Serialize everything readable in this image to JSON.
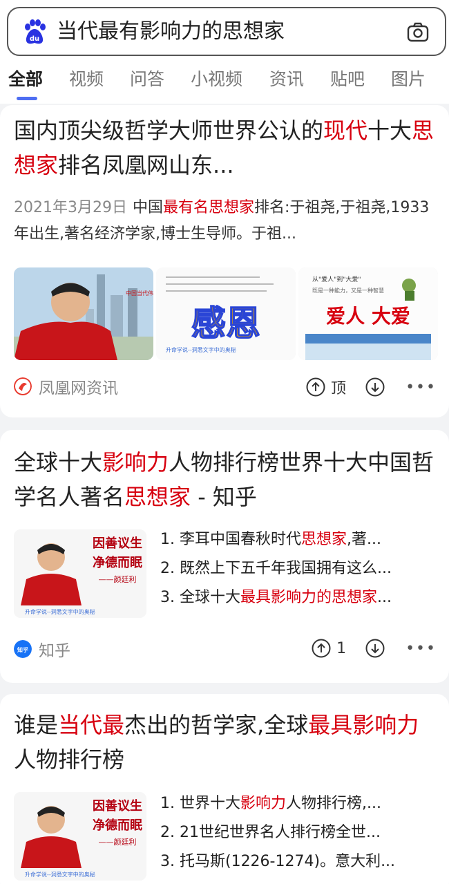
{
  "search": {
    "query": "当代最有影响力的思想家"
  },
  "tabs": [
    "全部",
    "视频",
    "问答",
    "小视频",
    "资讯",
    "贴吧",
    "图片"
  ],
  "cards": [
    {
      "title": {
        "p1": "国内顶尖级哲学大师世界公认的",
        "h1": "现代",
        "p2": "十大",
        "h2": "思想家",
        "p3": "排名凤凰网山东..."
      },
      "summary": {
        "date": "2021年3月29日",
        "p1": "中国",
        "h1": "最有名思想家",
        "p2": "排名:于祖尧,于祖尧,1933年出生,著名经济学家,博士生导师。于祖..."
      },
      "images": {
        "img1_text": "中国当代伟大的思想家",
        "img2_big": "感恩",
        "img2_caption": "升命学说--洞悉文字中的奥秘",
        "img3_top": "从\"爱人\"到\"大爱\"",
        "img3_sub": "既是一种能力，又是一种智慧",
        "img3_big": "爱人 大爱"
      },
      "source": "凤凰网资讯",
      "vote_label": "顶"
    },
    {
      "title": {
        "p1": "全球十大",
        "h1": "影响力",
        "p2": "人物排行榜世界十大中国哲学名人著名",
        "h2": "思想家",
        "p3": " - 知乎"
      },
      "image_text": {
        "poem1": "因善议生",
        "poem2": "净德而眠",
        "sign": "——颜廷利",
        "caption": "升命学说--洞悉文字中的奥秘"
      },
      "list": [
        {
          "p1": "1. 李耳中国春秋时代",
          "h": "思想家",
          "p2": ",著..."
        },
        {
          "p1": "2. 既然上下五千年我国拥有这么...",
          "h": "",
          "p2": ""
        },
        {
          "p1": "3. 全球十大",
          "h": "最具影响力的思想家",
          "p2": "..."
        }
      ],
      "source": "知乎",
      "source_icon_text": "知乎",
      "vote_count": "1"
    },
    {
      "title": {
        "p1": "谁是",
        "h1": "当代最",
        "p2": "杰出的哲学家,全球",
        "h2": "最具影响力",
        "p3": "人物排行榜"
      },
      "image_text": {
        "poem1": "因善议生",
        "poem2": "净德而眠",
        "sign": "——颜廷利",
        "caption": "升命学说--洞悉文字中的奥秘"
      },
      "list": [
        {
          "p1": "1. 世界十大",
          "h": "影响力",
          "p2": "人物排行榜,..."
        },
        {
          "p1": "2. 21世纪世界名人排行榜全世...",
          "h": "",
          "p2": ""
        },
        {
          "p1": "3. 托马斯(1226-1274)。意大利...",
          "h": "",
          "p2": ""
        }
      ]
    }
  ],
  "colors": {
    "highlight": "#d7000f",
    "accent": "#4e6ef2",
    "baidu_blue": "#2932e1"
  }
}
